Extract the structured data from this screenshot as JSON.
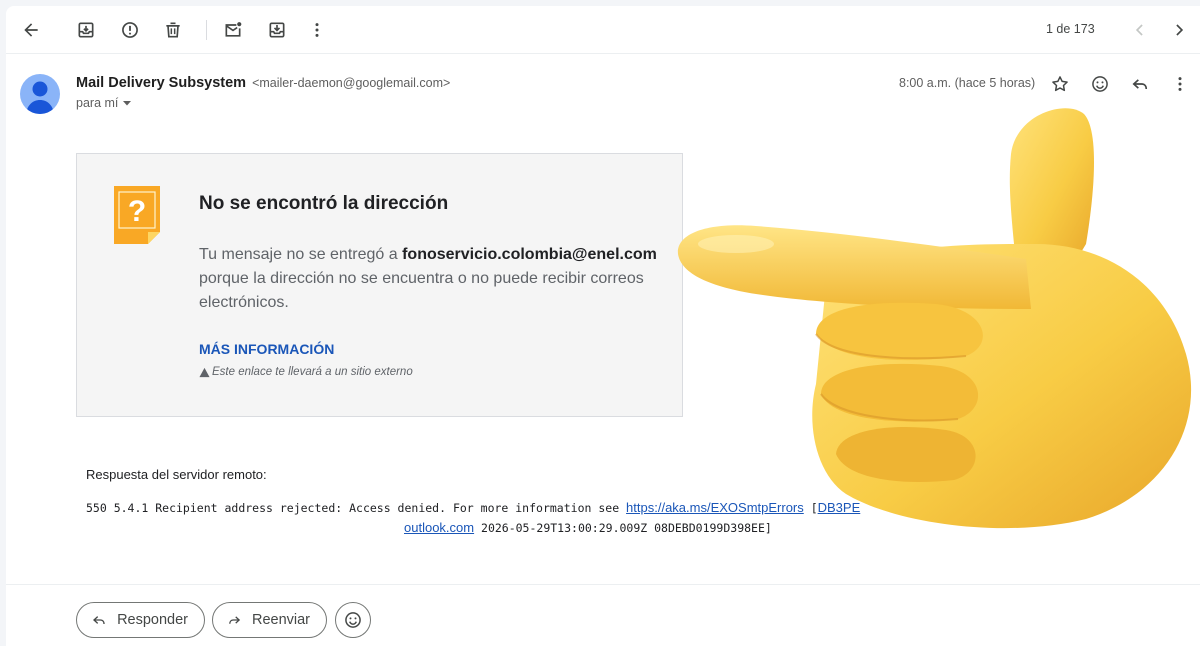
{
  "toolbar": {
    "pager_text": "1 de 173",
    "icons": [
      "back-arrow-icon",
      "archive-icon",
      "report-spam-icon",
      "delete-icon",
      "mark-unread-icon",
      "move-to-icon",
      "more-vert-icon",
      "chevron-left-icon",
      "chevron-right-icon"
    ]
  },
  "message": {
    "sender_name": "Mail Delivery Subsystem",
    "sender_email": "<mailer-daemon@googlemail.com>",
    "to_label": "para mí",
    "time": "8:00 a.m. (hace 5 horas)"
  },
  "bounce_card": {
    "title": "No se encontró la dirección",
    "message_prefix": "Tu mensaje no se entregó a ",
    "recipient": "fonoservicio.colombia@enel.com",
    "message_suffix": " porque la dirección no se encuentra o no puede recibir correos electrónicos.",
    "more_info_link": "MÁS INFORMACIÓN",
    "external_note": "Este enlace te llevará a un sitio externo"
  },
  "server_response": {
    "label": "Respuesta del servidor remoto:",
    "text_before_link": "550 5.4.1 Recipient address rejected: Access denied. For more information see ",
    "link1": "https://aka.ms/EXOSmtpErrors",
    "text_between": " [",
    "link2_visible": "DB3PE",
    "link2_tail": "outlook.com",
    "text_after": " 2026-05-29T13:00:29.009Z 08DEBD0199D398EE]"
  },
  "actions": {
    "reply_label": "Responder",
    "forward_label": "Reenviar"
  },
  "colors": {
    "link": "#1a56b8",
    "card_bg": "#f5f5f5",
    "warning_icon": "#f9a825",
    "avatar": "#8ab4f8"
  }
}
